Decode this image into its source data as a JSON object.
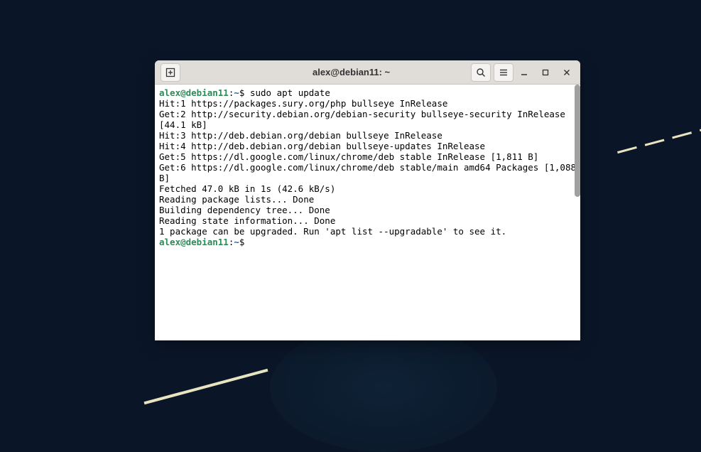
{
  "window": {
    "title": "alex@debian11: ~"
  },
  "prompt": {
    "user_host": "alex@debian11",
    "colon": ":",
    "path": "~",
    "dollar": "$ "
  },
  "command": "sudo apt update",
  "output": {
    "l1": "Hit:1 https://packages.sury.org/php bullseye InRelease",
    "l2": "Get:2 http://security.debian.org/debian-security bullseye-security InRelease [44.1 kB]",
    "l3": "Hit:3 http://deb.debian.org/debian bullseye InRelease",
    "l4": "Hit:4 http://deb.debian.org/debian bullseye-updates InRelease",
    "l5": "Get:5 https://dl.google.com/linux/chrome/deb stable InRelease [1,811 B]",
    "l6": "Get:6 https://dl.google.com/linux/chrome/deb stable/main amd64 Packages [1,088 B]",
    "l7": "Fetched 47.0 kB in 1s (42.6 kB/s)",
    "l8": "Reading package lists... Done",
    "l9": "Building dependency tree... Done",
    "l10": "Reading state information... Done",
    "l11": "1 package can be upgraded. Run 'apt list --upgradable' to see it."
  },
  "icons": {
    "new_tab": "new-tab",
    "search": "search",
    "menu": "menu",
    "minimize": "minimize",
    "maximize": "maximize",
    "close": "close"
  }
}
